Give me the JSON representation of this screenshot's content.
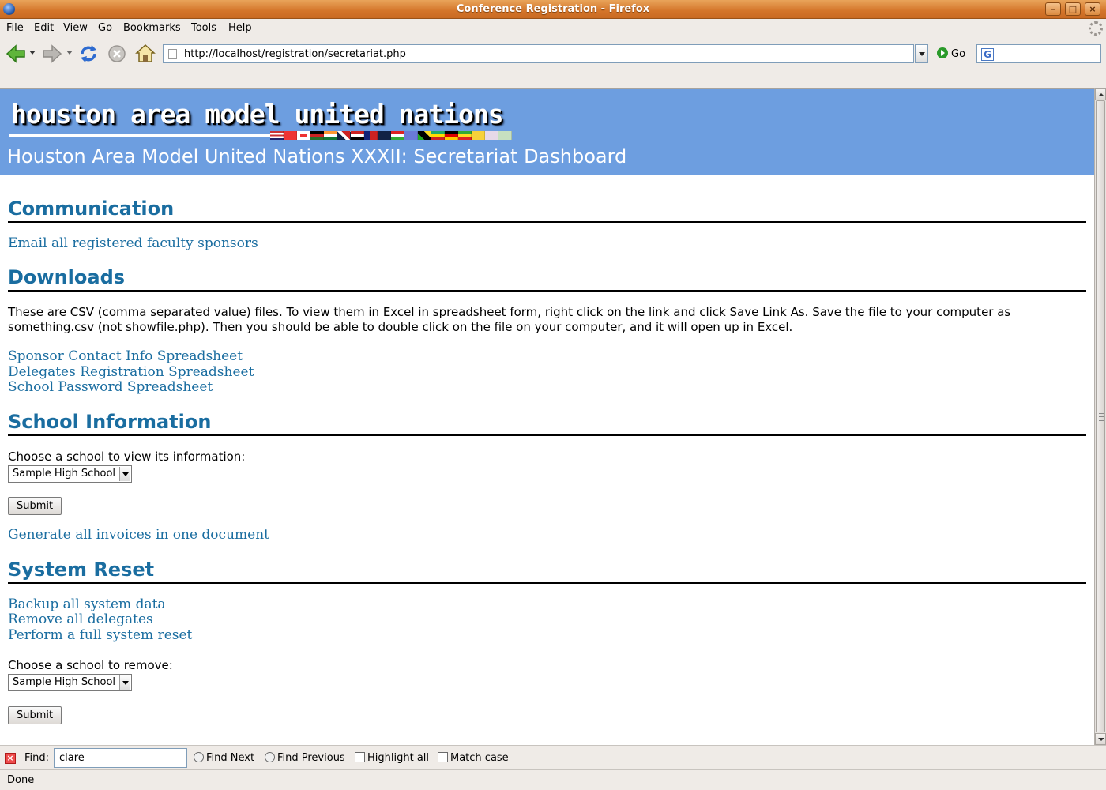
{
  "window": {
    "title": "Conference Registration - Firefox"
  },
  "menubar": {
    "items": [
      "File",
      "Edit",
      "View",
      "Go",
      "Bookmarks",
      "Tools",
      "Help"
    ]
  },
  "navbar": {
    "url": "http://localhost/registration/secretariat.php",
    "go_label": "Go"
  },
  "banner": {
    "logo_text": "houston area model united nations",
    "title": "Houston Area Model United Nations XXXII: Secretariat Dashboard"
  },
  "communication": {
    "heading": "Communication",
    "email_link": "Email all registered faculty sponsors"
  },
  "downloads": {
    "heading": "Downloads",
    "description": "These are CSV (comma separated value) files. To view them in Excel in spreadsheet form, right click on the link and click Save Link As. Save the file to your computer as something.csv (not showfile.php). Then you should be able to double click on the file on your computer, and it will open up in Excel.",
    "links": [
      "Sponsor Contact Info Spreadsheet",
      "Delegates Registration Spreadsheet",
      "School Password Spreadsheet"
    ]
  },
  "school_info": {
    "heading": "School Information",
    "label": "Choose a school to view its information:",
    "selected": "Sample High School",
    "submit": "Submit",
    "invoices_link": "Generate all invoices in one document"
  },
  "system_reset": {
    "heading": "System Reset",
    "links": [
      "Backup all system data",
      "Remove all delegates",
      "Perform a full system reset"
    ],
    "label": "Choose a school to remove:",
    "selected": "Sample High School",
    "submit": "Submit"
  },
  "findbar": {
    "label": "Find:",
    "query": "clare",
    "find_next": "Find Next",
    "find_previous": "Find Previous",
    "highlight_all": "Highlight all",
    "match_case": "Match case"
  },
  "status": {
    "text": "Done"
  },
  "colors": {
    "banner": "#6d9ee0",
    "link": "#1a6da0",
    "titlebar": "#d4752a"
  },
  "icons": {
    "back": "back-arrow-icon",
    "forward": "forward-arrow-icon",
    "reload": "reload-icon",
    "stop": "stop-icon",
    "home": "home-icon"
  }
}
